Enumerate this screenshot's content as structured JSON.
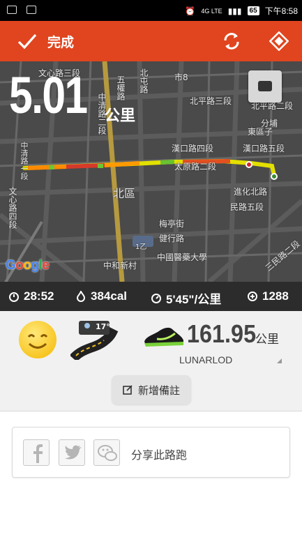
{
  "status_bar": {
    "network": "4G LTE",
    "battery": "65",
    "time": "下午8:58"
  },
  "top_bar": {
    "done_label": "完成",
    "check_icon": "check-icon",
    "refresh_icon": "refresh-icon",
    "navigate_icon": "navigate-diamond-icon",
    "accent": "#e0451f"
  },
  "distance": {
    "value": "5.01",
    "unit": "公里"
  },
  "map": {
    "labels": [
      "文心路三段",
      "中清路二段",
      "北屯路",
      "市8",
      "北平路三段",
      "五權路",
      "北平路二段",
      "分埔",
      "文心路四段",
      "漢口路四段",
      "漢口路五段",
      "太原路二段",
      "北區",
      "進化北路",
      "民路五段",
      "東區子",
      "梅亭街",
      "健行路",
      "中國醫藥大學",
      "1乙",
      "中清路一段",
      "三民路二段",
      "中和新村"
    ],
    "attribution": "Google"
  },
  "stats": [
    {
      "icon": "stopwatch-icon",
      "value": "28:52"
    },
    {
      "icon": "flame-icon",
      "value": "384cal"
    },
    {
      "icon": "pace-gauge-icon",
      "value": "5'45\"/公里"
    },
    {
      "icon": "steps-icon",
      "value": "1288"
    }
  ],
  "gear": {
    "mood_icon": "smile-face-icon",
    "weather_temp": "17°",
    "shoe_distance": "161.95",
    "shoe_unit": "公里",
    "shoe_model": "LUNARLOD",
    "add_note_label": "新增備註"
  },
  "share": {
    "label": "分享此路跑",
    "buttons": [
      "facebook-icon",
      "twitter-icon",
      "wechat-icon"
    ]
  }
}
